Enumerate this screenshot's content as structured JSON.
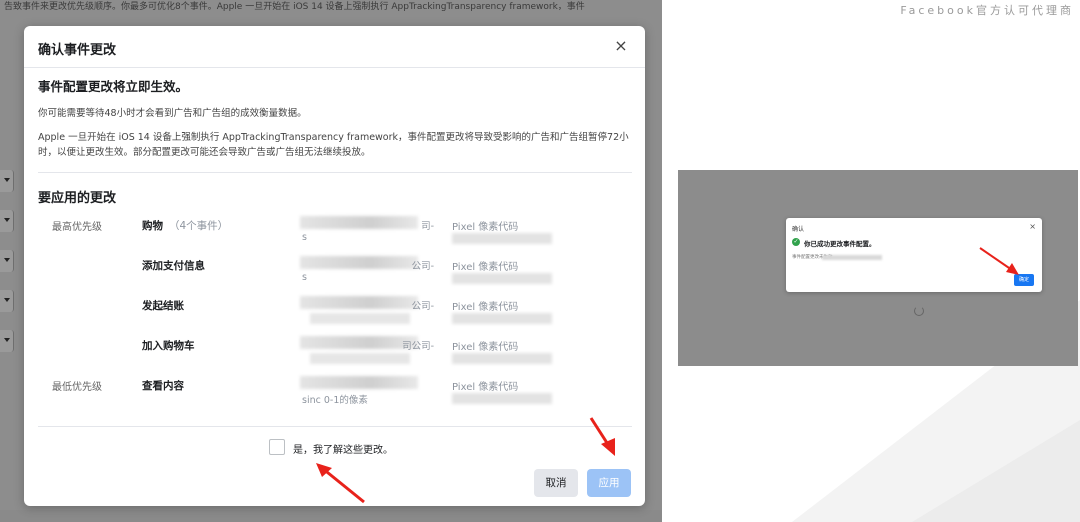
{
  "background": {
    "top_text": "告致事件来更改优先级顺序。你最多可优化8个事件。Apple 一旦开始在 iOS 14 设备上强制执行 AppTrackingTransparency framework，事件"
  },
  "modal": {
    "title": "确认事件更改",
    "close_symbol": "×",
    "effect_heading": "事件配置更改将立即生效。",
    "notice_1": "你可能需要等待48小时才会看到广告和广告组的成效衡量数据。",
    "notice_2": "Apple 一旦开始在 iOS 14 设备上强制执行 AppTrackingTransparency framework，事件配置更改将导致受影响的广告和广告组暂停72小时，以便让更改生效。部分配置更改可能还会导致广告或广告组无法继续投放。",
    "changes_heading": "要应用的更改",
    "rows": [
      {
        "priority": "最高优先级",
        "event": "购物",
        "count": "（4个事件）",
        "account": "司-",
        "account_sub": "s",
        "pixel": "Pixel 像素代码"
      },
      {
        "priority": "",
        "event": "添加支付信息",
        "count": "",
        "account": "公司-",
        "account_sub": "s",
        "pixel": "Pixel 像素代码"
      },
      {
        "priority": "",
        "event": "发起结账",
        "count": "",
        "account": "公司-",
        "account_sub": "",
        "pixel": "Pixel 像素代码"
      },
      {
        "priority": "",
        "event": "加入购物车",
        "count": "",
        "account": "司公司-",
        "account_sub": "",
        "pixel": "Pixel 像素代码"
      },
      {
        "priority": "最低优先级",
        "event": "查看内容",
        "count": "",
        "account": "",
        "account_sub": "sinc 0-1的像素",
        "pixel": "Pixel 像素代码"
      }
    ],
    "ack_label": "是，我了解这些更改。",
    "cancel_label": "取消",
    "apply_label": "应用"
  },
  "right": {
    "brand_text": "Facebook官方认可代理商",
    "mini_modal": {
      "title": "确认",
      "close_symbol": "×",
      "success_text": "你已成功更改事件配置。",
      "sub_text": "事件配置更改未生效",
      "confirm_label": "确定"
    }
  },
  "colors": {
    "primary_blue": "#1877f2",
    "disabled_blue": "#9cc3f6",
    "arrow_red": "#e8221b",
    "success_green": "#31a24c",
    "overlay_gray": "#8d8d8d"
  }
}
